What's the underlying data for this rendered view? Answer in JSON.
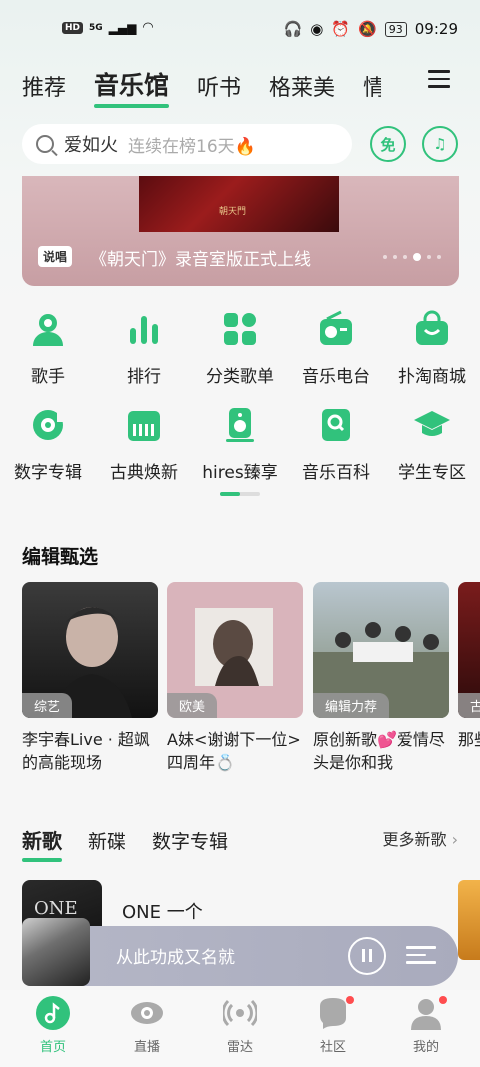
{
  "status_bar": {
    "left": [
      "HD",
      "5G"
    ],
    "battery": "93",
    "time": "09:29"
  },
  "top_tabs": [
    {
      "label": "推荐"
    },
    {
      "label": "音乐馆",
      "active": true
    },
    {
      "label": "听书"
    },
    {
      "label": "格莱美"
    },
    {
      "label": "情"
    }
  ],
  "search": {
    "query": "爱如火",
    "hint": "连续在榜16天🔥",
    "free_label": "免"
  },
  "banner": {
    "tag": "说唱",
    "title": "《朝天门》录音室版正式上线",
    "art_text": "朝天門"
  },
  "grid": [
    {
      "label": "歌手",
      "icon": "singer-icon"
    },
    {
      "label": "排行",
      "icon": "chart-icon"
    },
    {
      "label": "分类歌单",
      "icon": "category-icon"
    },
    {
      "label": "音乐电台",
      "icon": "radio-icon"
    },
    {
      "label": "扑淘商城",
      "icon": "shop-icon"
    },
    {
      "label": "数字专辑",
      "icon": "digital-album-icon"
    },
    {
      "label": "古典焕新",
      "icon": "piano-icon"
    },
    {
      "label": "hires臻享",
      "icon": "speaker-icon"
    },
    {
      "label": "音乐百科",
      "icon": "encyclopedia-icon"
    },
    {
      "label": "学生专区",
      "icon": "graduation-cap-icon"
    }
  ],
  "editor_picks": {
    "title": "编辑甄选",
    "cards": [
      {
        "badge": "综艺",
        "text": "李宇春Live · 超飒的高能现场"
      },
      {
        "badge": "欧美",
        "text": "A妹<谢谢下一位>四周年💍"
      },
      {
        "badge": "编辑力荐",
        "text": "原创新歌💕爱情尽头是你和我"
      },
      {
        "badge": "古",
        "text": "那些歌厅"
      }
    ]
  },
  "song_section": {
    "tabs": [
      {
        "label": "新歌",
        "active": true
      },
      {
        "label": "新碟"
      },
      {
        "label": "数字专辑"
      }
    ],
    "more": "更多新歌",
    "first_song": "ONE 一个",
    "cover_text": "ONE"
  },
  "player": {
    "title": "从此功成又名就"
  },
  "bottom_nav": [
    {
      "label": "首页",
      "active": true,
      "icon": "home-icon"
    },
    {
      "label": "直播",
      "icon": "live-icon"
    },
    {
      "label": "雷达",
      "icon": "radar-icon"
    },
    {
      "label": "社区",
      "icon": "community-icon",
      "dot": true
    },
    {
      "label": "我的",
      "icon": "profile-icon",
      "dot": true
    }
  ],
  "colors": {
    "accent": "#31c27c"
  }
}
